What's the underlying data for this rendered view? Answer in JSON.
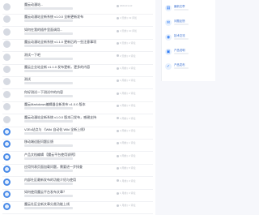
{
  "rows": [
    {
      "title": "魔云动漫站...",
      "meta": "2024-01-10",
      "avatar": "gray"
    },
    {
      "title": "魔云动漫站全新系统 v1.0.0 全新更新发布",
      "meta": "4 天前 | 19 评论",
      "avatar": "gray"
    },
    {
      "title": "如何在我的插件里面调用...",
      "meta": "4 天前 | 10 评论",
      "avatar": "gray"
    },
    {
      "title": "魔云动漫站全新系统 v1.1.0 更新后的一些注意事项",
      "meta": "6 天前 | 2 评论",
      "avatar": "gray"
    },
    {
      "title": "测试一下吧",
      "meta": "2 天前 | 0 评论",
      "avatar": "gray"
    },
    {
      "title": "魔云企业站全新 v1.1.0 发布更新，更多的内容",
      "meta": "1 周前 | 4 评论",
      "avatar": "gray"
    },
    {
      "title": "测试",
      "meta": "1 周前 | 0 评论",
      "avatar": "gray"
    },
    {
      "title": "你好测试一下测试中的内容",
      "meta": "1 周前 | 2 评论",
      "avatar": "gray"
    },
    {
      "title": "魔云Markdown编辑器全新发布 v1.0.0 版本",
      "meta": "2 周前 | 6 评论",
      "avatar": "gray"
    },
    {
      "title": "魔云动漫站全新系统 v1.0.0 版本已发布，感谢支持",
      "meta": "2 周前 | 3 评论",
      "avatar": "gray"
    },
    {
      "title": "V2Ex站点与 《Wiki 自动化 Wiki 全新上线》",
      "meta": "2 周前 | 0 评论",
      "avatar": "blue"
    },
    {
      "title": "移动端适配问题反馈",
      "meta": "3 周前 | 1 评论",
      "avatar": "blue"
    },
    {
      "title": "产品文档编辑 【魔云平台使用说明】",
      "meta": "3 周前 | 2 评论",
      "avatar": "blue"
    },
    {
      "title": "应用列表页面加载问题，需要进一步排查",
      "meta": "3 周前 | 5 评论",
      "avatar": "blue"
    },
    {
      "title": "内部社区最新发布的功能介绍与使用",
      "meta": "1 月前 | 0 评论",
      "avatar": "blue"
    },
    {
      "title": "如何使用魔云平台发布文章？",
      "meta": "1 月前 | 3 评论",
      "avatar": "blue"
    },
    {
      "title": "魔云社区全新文章分类功能上线",
      "meta": "1 月前 | 1 评论",
      "avatar": "blue"
    }
  ],
  "side_items": [
    {
      "label": "最新文章",
      "icon": "article-icon"
    },
    {
      "label": "问题反馈",
      "icon": "feedback-icon"
    },
    {
      "label": "技术交流",
      "icon": "chat-icon"
    },
    {
      "label": "产品说明",
      "icon": "doc-icon"
    },
    {
      "label": "产品发布",
      "icon": "release-icon"
    }
  ]
}
